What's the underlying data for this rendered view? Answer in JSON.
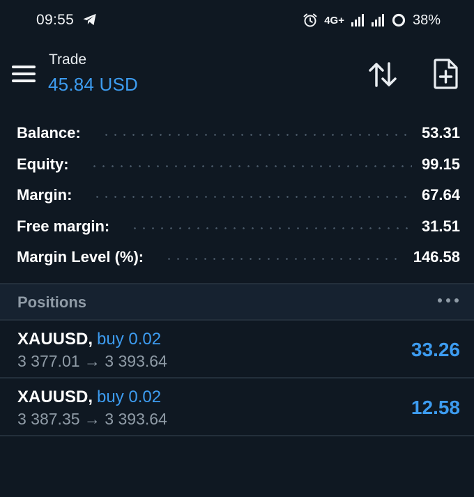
{
  "status_bar": {
    "time": "09:55",
    "network": "4G+",
    "battery": "38%",
    "icons": [
      "telegram-icon",
      "alarm-icon",
      "signal-icon",
      "signal-icon",
      "battery-ring-icon"
    ]
  },
  "header": {
    "title": "Trade",
    "balance": "45.84 USD",
    "icons": [
      "menu-icon",
      "sort-icon",
      "new-order-icon"
    ]
  },
  "account": {
    "rows": [
      {
        "label": "Balance:",
        "value": "53.31"
      },
      {
        "label": "Equity:",
        "value": "99.15"
      },
      {
        "label": "Margin:",
        "value": "67.64"
      },
      {
        "label": "Free margin:",
        "value": "31.51"
      },
      {
        "label": "Margin Level (%):",
        "value": "146.58"
      }
    ]
  },
  "positions": {
    "title": "Positions",
    "items": [
      {
        "symbol": "XAUUSD",
        "type": "buy 0.02",
        "prices": "3 377.01 → 3 393.64",
        "profit": "33.26"
      },
      {
        "symbol": "XAUUSD",
        "type": "buy 0.02",
        "prices": "3 387.35 → 3 393.64",
        "profit": "12.58"
      }
    ]
  },
  "colors": {
    "background": "#0f1822",
    "accent": "#3d9cf0",
    "muted": "#8f9ba6",
    "section_bg": "#162230"
  }
}
